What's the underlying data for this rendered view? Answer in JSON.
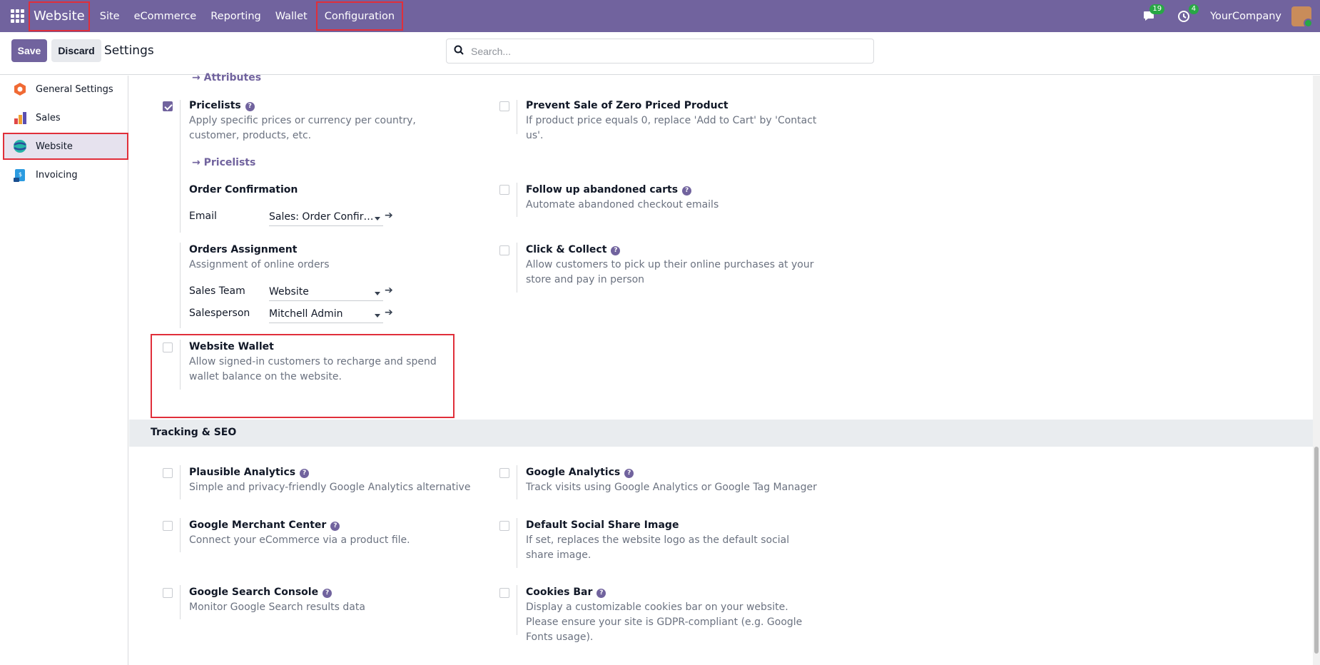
{
  "navbar": {
    "app_name": "Website",
    "menu": [
      "Site",
      "eCommerce",
      "Reporting",
      "Wallet",
      "Configuration"
    ],
    "messages_count": "19",
    "activities_count": "4",
    "company": "YourCompany"
  },
  "control": {
    "save_label": "Save",
    "discard_label": "Discard",
    "title": "Settings",
    "search_placeholder": "Search..."
  },
  "sidebar": {
    "items": [
      {
        "label": "General Settings",
        "icon": "general-settings-icon"
      },
      {
        "label": "Sales",
        "icon": "sales-icon"
      },
      {
        "label": "Website",
        "icon": "website-icon"
      },
      {
        "label": "Invoicing",
        "icon": "invoicing-icon"
      }
    ]
  },
  "content": {
    "attributes_link": "→ Attributes",
    "pricelists": {
      "title": "Pricelists",
      "desc": "Apply specific prices or currency per country, customer, products, etc.",
      "link": "→ Pricelists",
      "checked": true
    },
    "zero_price": {
      "title": "Prevent Sale of Zero Priced Product",
      "desc": "If product price equals 0, replace 'Add to Cart' by 'Contact us'."
    },
    "order_confirmation": {
      "title": "Order Confirmation",
      "email_label": "Email",
      "email_value": "Sales: Order Confir…"
    },
    "abandoned_carts": {
      "title": "Follow up abandoned carts",
      "desc": "Automate abandoned checkout emails"
    },
    "orders_assignment": {
      "title": "Orders Assignment",
      "desc": "Assignment of online orders",
      "team_label": "Sales Team",
      "team_value": "Website",
      "person_label": "Salesperson",
      "person_value": "Mitchell Admin"
    },
    "click_collect": {
      "title": "Click & Collect",
      "desc": "Allow customers to pick up their online purchases at your store and pay in person"
    },
    "website_wallet": {
      "title": "Website Wallet",
      "desc": "Allow signed-in customers to recharge and spend wallet balance on the website."
    },
    "tracking_header": "Tracking & SEO",
    "plausible": {
      "title": "Plausible Analytics",
      "desc": "Simple and privacy-friendly Google Analytics alternative"
    },
    "google_analytics": {
      "title": "Google Analytics",
      "desc": "Track visits using Google Analytics or Google Tag Manager"
    },
    "merchant": {
      "title": "Google Merchant Center",
      "desc": "Connect your eCommerce via a product file."
    },
    "social_image": {
      "title": "Default Social Share Image",
      "desc": "If set, replaces the website logo as the default social share image."
    },
    "search_console": {
      "title": "Google Search Console",
      "desc": "Monitor Google Search results data"
    },
    "cookies": {
      "title": "Cookies Bar",
      "desc": "Display a customizable cookies bar on your website. Please ensure your site is GDPR-compliant (e.g. Google Fonts usage)."
    }
  },
  "colors": {
    "brand": "#71639e",
    "highlight": "#e02f3a"
  }
}
